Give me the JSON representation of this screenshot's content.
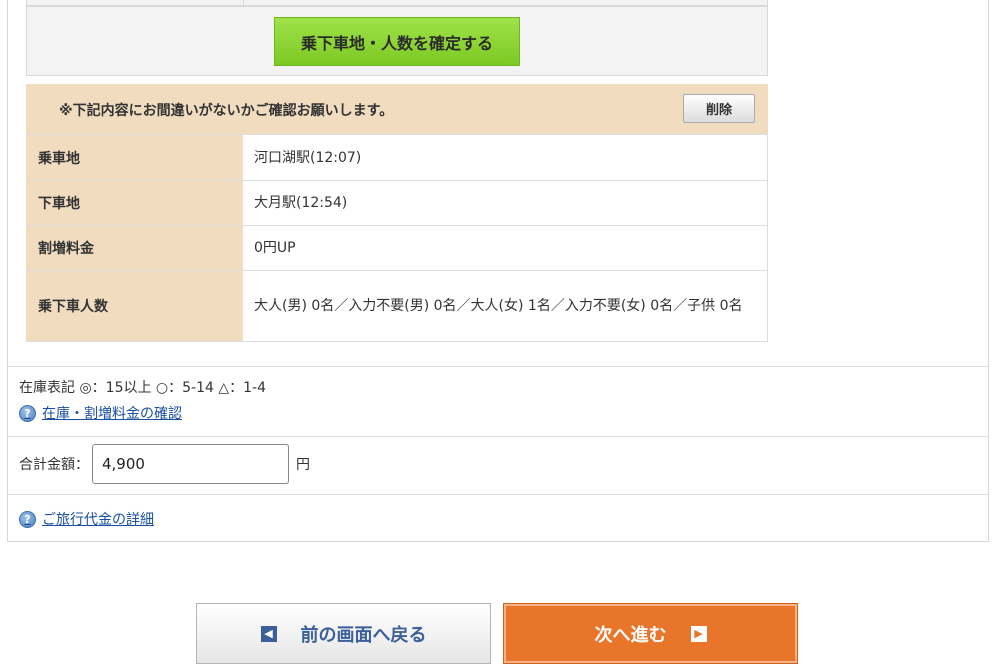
{
  "confirm": {
    "button_label": "乗下車地・人数を確定する"
  },
  "details": {
    "notice": "※下記内容にお間違いがないかご確認お願いします。",
    "delete_label": "削除",
    "rows": [
      {
        "label": "乗車地",
        "value": "河口湖駅(12:07)"
      },
      {
        "label": "下車地",
        "value": "大月駅(12:54)"
      },
      {
        "label": "割増料金",
        "value": "0円UP"
      },
      {
        "label": "乗下車人数",
        "value": "大人(男) 0名／入力不要(男) 0名／大人(女) 1名／入力不要(女) 0名／子供 0名"
      }
    ]
  },
  "stock": {
    "legend": "在庫表記 ◎：15以上 ○：5-14 △：1-4",
    "help_link": "在庫・割増料金の確認"
  },
  "total": {
    "label": "合計金額：",
    "value": "4,900",
    "unit": "円"
  },
  "travel_fee": {
    "help_link": "ご旅行代金の詳細"
  },
  "nav": {
    "back_label": "前の画面へ戻る",
    "next_label": "次へ進む"
  },
  "icons": {
    "help": "question-circle-icon",
    "back": "arrow-left-box-icon",
    "next": "arrow-right-box-icon"
  },
  "colors": {
    "confirm_green": "#7cc923",
    "label_beige": "#f1dcc0",
    "next_orange": "#e8752a",
    "link_blue": "#1a4fa0"
  }
}
